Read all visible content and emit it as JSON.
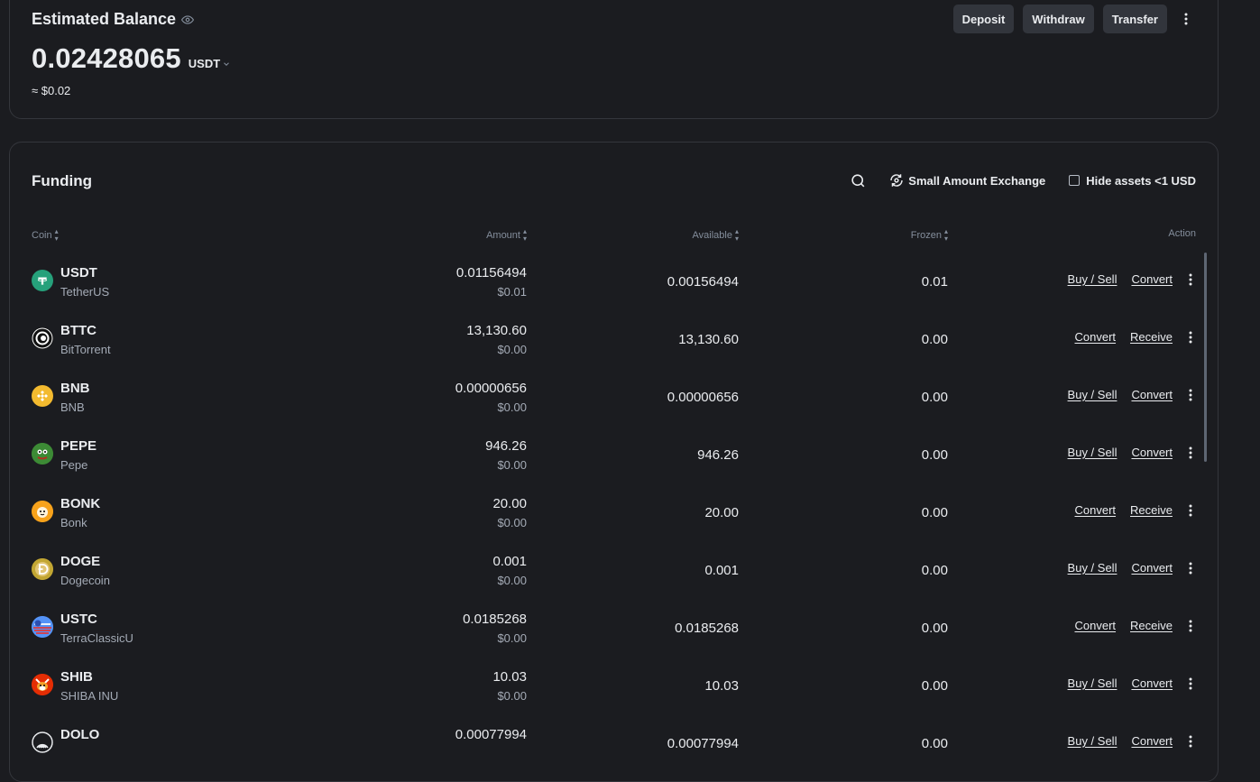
{
  "balance": {
    "title": "Estimated Balance",
    "amount": "0.02428065",
    "unit": "USDT",
    "approx": "≈ $0.02",
    "buttons": {
      "deposit": "Deposit",
      "withdraw": "Withdraw",
      "transfer": "Transfer"
    }
  },
  "funding": {
    "title": "Funding",
    "small_amount_exchange": "Small Amount Exchange",
    "hide_assets": "Hide assets <1 USD",
    "columns": {
      "coin": "Coin",
      "amount": "Amount",
      "available": "Available",
      "frozen": "Frozen",
      "action": "Action"
    },
    "rows": [
      {
        "symbol": "USDT",
        "name": "TetherUS",
        "amount": "0.01156494",
        "amount_usd": "$0.01",
        "available": "0.00156494",
        "frozen": "0.01",
        "action1": "Buy / Sell",
        "action2": "Convert",
        "icon": "usdt-icon",
        "color": "#26a17b"
      },
      {
        "symbol": "BTTC",
        "name": "BitTorrent",
        "amount": "13,130.60",
        "amount_usd": "$0.00",
        "available": "13,130.60",
        "frozen": "0.00",
        "action1": "Convert",
        "action2": "Receive",
        "icon": "bttc-icon",
        "color": "#111111"
      },
      {
        "symbol": "BNB",
        "name": "BNB",
        "amount": "0.00000656",
        "amount_usd": "$0.00",
        "available": "0.00000656",
        "frozen": "0.00",
        "action1": "Buy / Sell",
        "action2": "Convert",
        "icon": "bnb-icon",
        "color": "#f3ba2f"
      },
      {
        "symbol": "PEPE",
        "name": "Pepe",
        "amount": "946.26",
        "amount_usd": "$0.00",
        "available": "946.26",
        "frozen": "0.00",
        "action1": "Buy / Sell",
        "action2": "Convert",
        "icon": "pepe-icon",
        "color": "#3c8a35"
      },
      {
        "symbol": "BONK",
        "name": "Bonk",
        "amount": "20.00",
        "amount_usd": "$0.00",
        "available": "20.00",
        "frozen": "0.00",
        "action1": "Convert",
        "action2": "Receive",
        "icon": "bonk-icon",
        "color": "#f7a21b"
      },
      {
        "symbol": "DOGE",
        "name": "Dogecoin",
        "amount": "0.001",
        "amount_usd": "$0.00",
        "available": "0.001",
        "frozen": "0.00",
        "action1": "Buy / Sell",
        "action2": "Convert",
        "icon": "doge-icon",
        "color": "#c2a633"
      },
      {
        "symbol": "USTC",
        "name": "TerraClassicU",
        "amount": "0.0185268",
        "amount_usd": "$0.00",
        "available": "0.0185268",
        "frozen": "0.00",
        "action1": "Convert",
        "action2": "Receive",
        "icon": "ustc-icon",
        "color": "#5493f7"
      },
      {
        "symbol": "SHIB",
        "name": "SHIBA INU",
        "amount": "10.03",
        "amount_usd": "$0.00",
        "available": "10.03",
        "frozen": "0.00",
        "action1": "Buy / Sell",
        "action2": "Convert",
        "icon": "shib-icon",
        "color": "#e42d04"
      },
      {
        "symbol": "DOLO",
        "name": "",
        "amount": "0.00077994",
        "amount_usd": "",
        "available": "0.00077994",
        "frozen": "0.00",
        "action1": "Buy / Sell",
        "action2": "Convert",
        "icon": "dolo-icon",
        "color": "#1b1c20"
      }
    ]
  },
  "colors": {
    "background": "#1b1c20",
    "border": "#34363c",
    "button": "#32353c",
    "text": "#eaecef",
    "muted": "#848e9c"
  }
}
